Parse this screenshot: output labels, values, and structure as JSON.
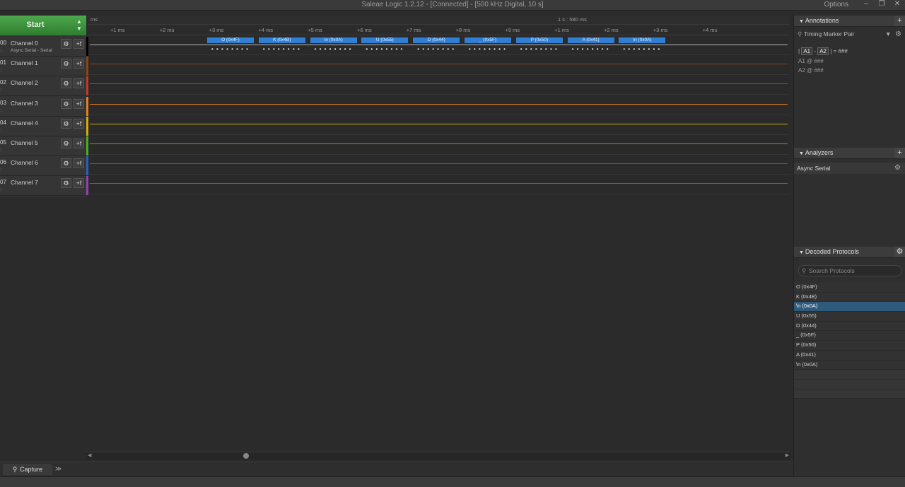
{
  "window": {
    "title": "Saleae Logic 1.2.12 - [Connected] - [500 kHz Digital, 10 s]",
    "options_label": "Options",
    "minimize": "–",
    "restore": "❐",
    "close": "✕"
  },
  "controls": {
    "start_label": "Start",
    "up_arrow": "▲",
    "down_arrow": "▼"
  },
  "channels": [
    {
      "num": "00",
      "name": "Channel 0",
      "sub": "Async Serial - Serial",
      "color": "#000000"
    },
    {
      "num": "01",
      "name": "Channel 1",
      "sub": "",
      "color": "#8b4513"
    },
    {
      "num": "02",
      "name": "Channel 2",
      "sub": "",
      "color": "#c0392b"
    },
    {
      "num": "03",
      "name": "Channel 3",
      "sub": "",
      "color": "#e67e22"
    },
    {
      "num": "04",
      "name": "Channel 4",
      "sub": "",
      "color": "#d4ac0d"
    },
    {
      "num": "05",
      "name": "Channel 5",
      "sub": "",
      "color": "#4caf20"
    },
    {
      "num": "06",
      "name": "Channel 6",
      "sub": "",
      "color": "#2e5fbf"
    },
    {
      "num": "07",
      "name": "Channel 7",
      "sub": "",
      "color": "#8e44ad"
    }
  ],
  "channel_buttons": {
    "gear": "⚙",
    "trigger": "+f"
  },
  "timeline": {
    "unit_label": "ms",
    "marker_label": "1 s : 580 ms",
    "ticks": [
      "+1 ms",
      "+2 ms",
      "+3 ms",
      "+4 ms",
      "+5 ms",
      "+6 ms",
      "+7 ms",
      "+8 ms",
      "+9 ms",
      "+1 ms",
      "+2 ms",
      "+3 ms",
      "+4 ms"
    ]
  },
  "decoded_frames": [
    "O (0x4F)",
    "K (0x4B)",
    "\\n (0x0A)",
    "U (0x55)",
    "D (0x44)",
    "_ (0x5F)",
    "P (0x50)",
    "A (0x41)",
    "\\n (0x0A)"
  ],
  "bits_dots": "• • • • • • • •",
  "annotations": {
    "header": "Annotations",
    "add": "+",
    "selector": "Timing Marker Pair",
    "a1": "A1",
    "a2": "A2",
    "delta_label": "= ###",
    "row1": "A1  @  ###",
    "row2": "A2  @  ###"
  },
  "analyzers": {
    "header": "Analyzers",
    "add": "+",
    "items": [
      "Async Serial"
    ]
  },
  "decoded_protocols": {
    "header": "Decoded Protocols",
    "search_placeholder": "Search Protocols",
    "items": [
      "O (0x4F)",
      "K (0x4B)",
      "\\n (0x0A)",
      "U (0x55)",
      "D (0x44)",
      "_ (0x5F)",
      "P (0x50)",
      "A (0x41)",
      "\\n (0x0A)"
    ],
    "selected_index": 2
  },
  "bottom": {
    "capture_tab": "Capture",
    "more_tab": "≫"
  }
}
